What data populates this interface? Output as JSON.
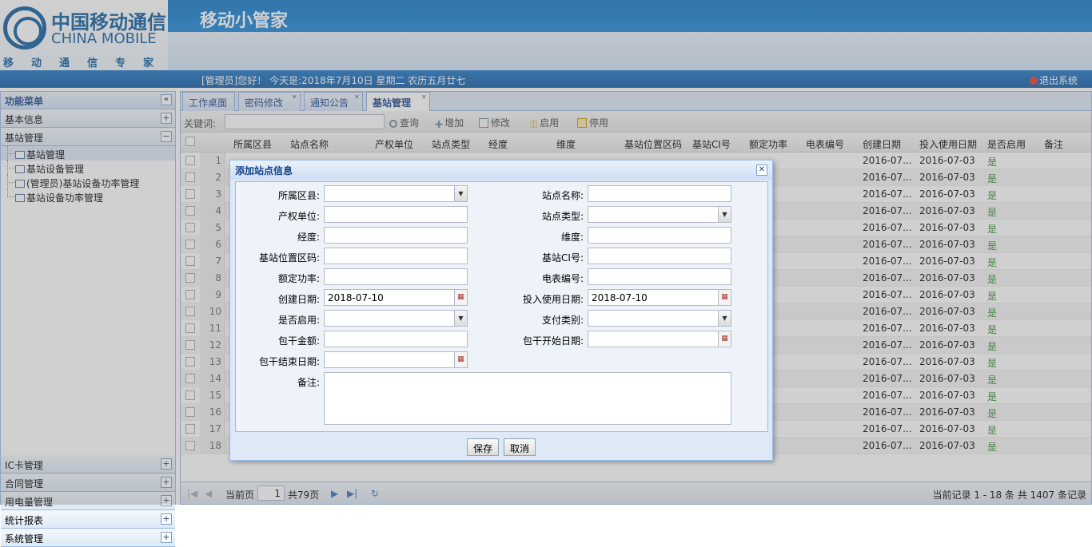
{
  "header": {
    "logo_cn": "中国移动通信",
    "logo_en": "CHINA MOBILE",
    "logo_sub": "移动通信专家",
    "app_title": "移动小管家",
    "greeting": "[管理员]您好！ 今天是:2018年7月10日 星期二 农历五月廿七",
    "logout": "退出系统"
  },
  "sidebar": {
    "title": "功能菜单",
    "groups_top": [
      {
        "label": "基本信息",
        "btn": "+"
      },
      {
        "label": "基站管理",
        "btn": "−"
      }
    ],
    "sub_items": [
      {
        "label": "基站管理"
      },
      {
        "label": "基站设备管理"
      },
      {
        "label": "(管理员)基站设备功率管理"
      },
      {
        "label": "基站设备功率管理"
      }
    ],
    "groups_bottom": [
      {
        "label": "IC卡管理",
        "btn": "+"
      },
      {
        "label": "合同管理",
        "btn": "+"
      },
      {
        "label": "用电量管理",
        "btn": "+"
      },
      {
        "label": "统计报表",
        "btn": "+"
      },
      {
        "label": "系统管理",
        "btn": "+"
      }
    ]
  },
  "tabs": [
    {
      "label": "工作桌面"
    },
    {
      "label": "密码修改"
    },
    {
      "label": "通知公告"
    },
    {
      "label": "基站管理"
    }
  ],
  "toolbar": {
    "keyword_label": "关键词:",
    "query": "查询",
    "add": "增加",
    "edit": "修改",
    "enable": "启用",
    "disable": "停用"
  },
  "grid": {
    "columns": [
      "所属区县",
      "站点名称",
      "产权单位",
      "站点类型",
      "经度",
      "维度",
      "基站位置区码",
      "基站CI号",
      "额定功率",
      "电表编号",
      "创建日期",
      "投入使用日期",
      "是否启用",
      "备注"
    ],
    "rows": [
      {
        "n": "1",
        "c": "2016-07...",
        "u": "2016-07-03",
        "e": "是"
      },
      {
        "n": "2",
        "c": "2016-07...",
        "u": "2016-07-03",
        "e": "是"
      },
      {
        "n": "3",
        "c": "2016-07...",
        "u": "2016-07-03",
        "e": "是"
      },
      {
        "n": "4",
        "c": "2016-07...",
        "u": "2016-07-03",
        "e": "是"
      },
      {
        "n": "5",
        "c": "2016-07...",
        "u": "2016-07-03",
        "e": "是"
      },
      {
        "n": "6",
        "c": "2016-07...",
        "u": "2016-07-03",
        "e": "是"
      },
      {
        "n": "7",
        "c": "2016-07...",
        "u": "2016-07-03",
        "e": "是"
      },
      {
        "n": "8",
        "c": "2016-07...",
        "u": "2016-07-03",
        "e": "是"
      },
      {
        "n": "9",
        "c": "2016-07...",
        "u": "2016-07-03",
        "e": "是"
      },
      {
        "n": "10",
        "c": "2016-07...",
        "u": "2016-07-03",
        "e": "是"
      },
      {
        "n": "11",
        "c": "2016-07...",
        "u": "2016-07-03",
        "e": "是"
      },
      {
        "n": "12",
        "c": "2016-07...",
        "u": "2016-07-03",
        "e": "是"
      },
      {
        "n": "13",
        "c": "2016-07...",
        "u": "2016-07-03",
        "e": "是"
      },
      {
        "n": "14",
        "c": "2016-07...",
        "u": "2016-07-03",
        "e": "是"
      },
      {
        "n": "15",
        "c": "2016-07...",
        "u": "2016-07-03",
        "e": "是"
      },
      {
        "n": "16",
        "c": "2016-07...",
        "u": "2016-07-03",
        "e": "是"
      },
      {
        "n": "17",
        "c": "2016-07...",
        "u": "2016-07-03",
        "e": "是"
      },
      {
        "n": "18",
        "c": "2016-07...",
        "u": "2016-07-03",
        "e": "是"
      }
    ]
  },
  "pager": {
    "current_label": "当前页",
    "page": "1",
    "total_pages": "共79页",
    "summary": "当前记录 1 - 18 条 共 1407 条记录"
  },
  "dialog": {
    "title": "添加站点信息",
    "fields": {
      "county": "所属区县:",
      "site_name": "站点名称:",
      "owner": "产权单位:",
      "site_type": "站点类型:",
      "longitude": "经度:",
      "latitude": "维度:",
      "lac": "基站位置区码:",
      "ci": "基站CI号:",
      "power": "额定功率:",
      "meter": "电表编号:",
      "created": "创建日期:",
      "created_val": "2018-07-10",
      "in_use": "投入使用日期:",
      "in_use_val": "2018-07-10",
      "enabled": "是否启用:",
      "pay_type": "支付类别:",
      "lump_amount": "包干金额:",
      "lump_start": "包干开始日期:",
      "lump_end": "包干结束日期:",
      "remark": "备注:"
    },
    "save": "保存",
    "cancel": "取消"
  },
  "colors": {
    "accent": "#15428b",
    "banner": "#0b74c6",
    "enabled_text": "#2e8b2e"
  }
}
